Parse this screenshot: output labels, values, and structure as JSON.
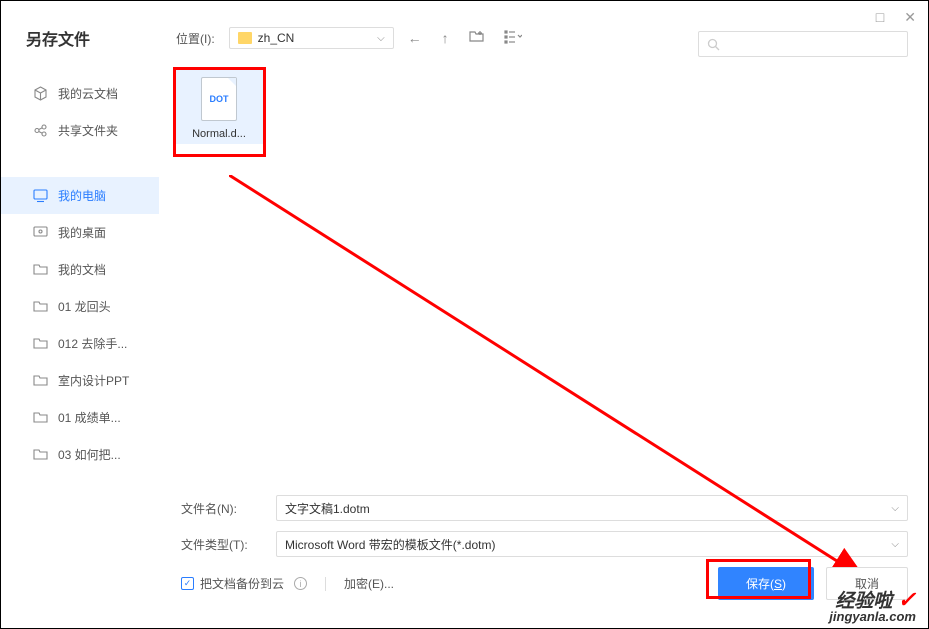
{
  "window": {
    "title": "另存文件",
    "maximize": "□",
    "close": "✕"
  },
  "location": {
    "label": "位置(I):",
    "folder": "zh_CN"
  },
  "search": {
    "placeholder": ""
  },
  "sidebar": {
    "items": [
      {
        "label": "我的云文档"
      },
      {
        "label": "共享文件夹"
      },
      {
        "label": "我的电脑"
      },
      {
        "label": "我的桌面"
      },
      {
        "label": "我的文档"
      },
      {
        "label": "01 龙回头"
      },
      {
        "label": "012 去除手..."
      },
      {
        "label": "室内设计PPT"
      },
      {
        "label": "01 成绩单..."
      },
      {
        "label": "03 如何把..."
      }
    ]
  },
  "files": {
    "item": {
      "type": "DOT",
      "name": "Normal.d..."
    }
  },
  "bottom": {
    "filename_label": "文件名(N):",
    "filename_value": "文字文稿1.dotm",
    "filetype_label": "文件类型(T):",
    "filetype_value": "Microsoft Word 带宏的模板文件(*.dotm)",
    "backup_label": "把文档备份到云",
    "encrypt_label": "加密(E)...",
    "save_button": "保存(",
    "save_key": "S",
    "save_close": ")",
    "cancel_button": "取消"
  },
  "watermark": {
    "top": "经验啦",
    "bottom": "jingyanla.com"
  }
}
